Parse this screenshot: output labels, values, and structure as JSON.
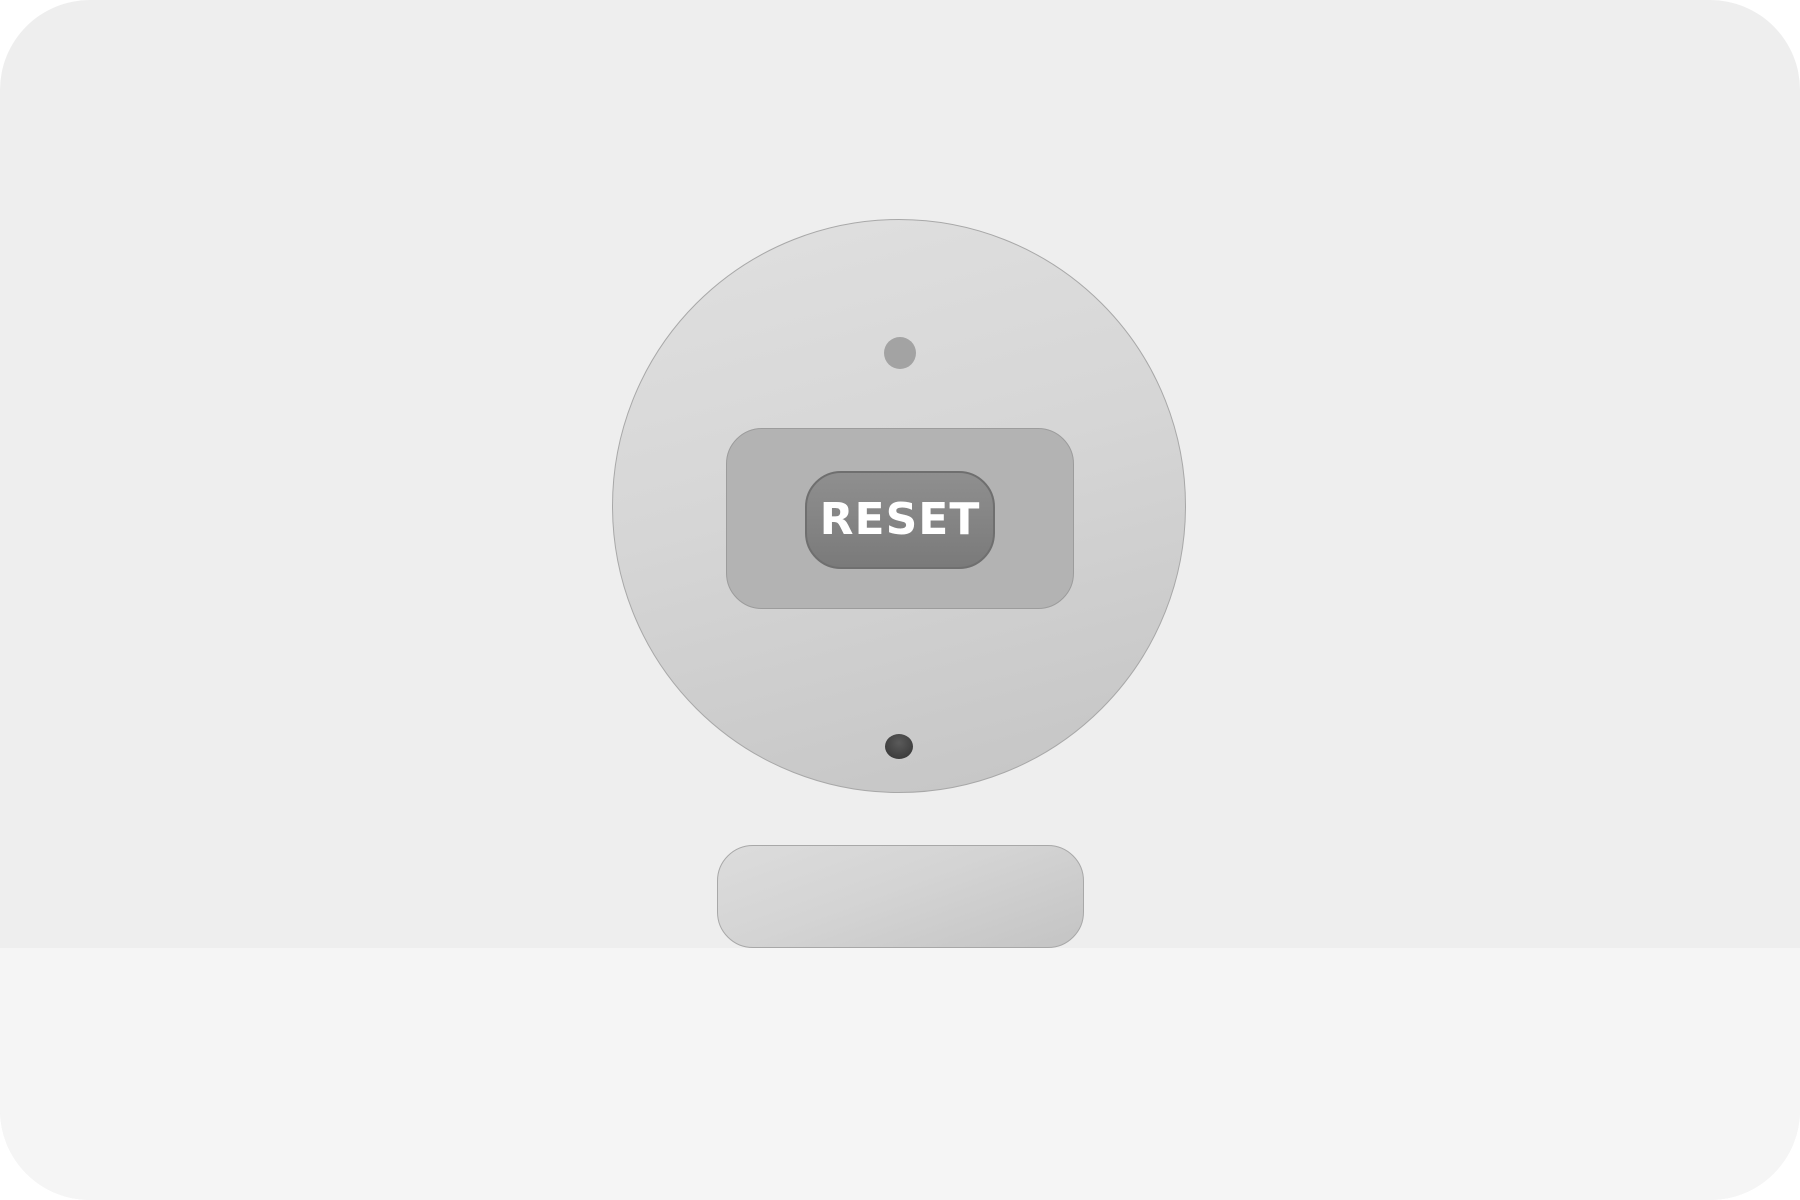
{
  "device": {
    "reset_button": {
      "label": "RESET"
    },
    "indicator_led": "status-led-icon",
    "pinhole": "pinhole-icon"
  },
  "colors": {
    "background": "#eeeeee",
    "floor": "#f5f5f5",
    "device_body": "#d6d6d6",
    "button_plate": "#b3b3b3",
    "reset_button": "#808080",
    "reset_label": "#ffffff",
    "led": "#a3a3a3"
  }
}
